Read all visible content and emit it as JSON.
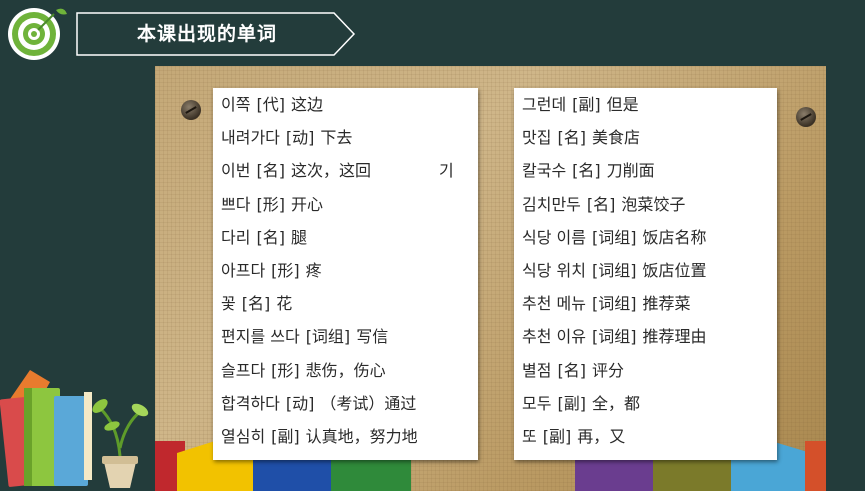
{
  "header": {
    "title": "本课出现的单词"
  },
  "colors": {
    "background": "#233c3b",
    "accent_green": "#6fb33a"
  },
  "icons": [
    "target-icon",
    "books-icon",
    "plant-icon"
  ],
  "vocab_left": [
    {
      "word": "이쪽",
      "pos": "[代]",
      "meaning": "这边"
    },
    {
      "word": "내려가다",
      "pos": "[动]",
      "meaning": "下去"
    },
    {
      "word": "이번",
      "pos": "[名]",
      "meaning": "这次，这回",
      "extra": "기"
    },
    {
      "word": "쁘다",
      "pos": "[形]",
      "meaning": "开心"
    },
    {
      "word": "다리",
      "pos": "[名]",
      "meaning": "腿"
    },
    {
      "word": "아프다",
      "pos": "[形]",
      "meaning": "疼"
    },
    {
      "word": "꽃",
      "pos": "[名]",
      "meaning": "花"
    },
    {
      "word": "편지를 쓰다",
      "pos": "[词组]",
      "meaning": "写信"
    },
    {
      "word": "슬프다",
      "pos": "[形]",
      "meaning": "悲伤，伤心"
    },
    {
      "word": "합격하다",
      "pos": "[动]",
      "meaning": "（考试）通过"
    },
    {
      "word": "열심히",
      "pos": "[副]",
      "meaning": "认真地，努力地"
    }
  ],
  "vocab_right": [
    {
      "word": "그런데",
      "pos": "[副]",
      "meaning": "但是"
    },
    {
      "word": "맛집",
      "pos": "[名]",
      "meaning": "美食店"
    },
    {
      "word": "칼국수",
      "pos": "[名]",
      "meaning": "刀削面"
    },
    {
      "word": "김치만두",
      "pos": "[名]",
      "meaning": "泡菜饺子"
    },
    {
      "word": "식당 이름",
      "pos": "[词组]",
      "meaning": "饭店名称"
    },
    {
      "word": "식당 위치",
      "pos": "[词组]",
      "meaning": "饭店位置"
    },
    {
      "word": "추천 메뉴",
      "pos": "[词组]",
      "meaning": "推荐菜"
    },
    {
      "word": "추천 이유",
      "pos": "[词组]",
      "meaning": "推荐理由"
    },
    {
      "word": "별점",
      "pos": "[名]",
      "meaning": "评分"
    },
    {
      "word": "모두",
      "pos": "[副]",
      "meaning": "全，都"
    },
    {
      "word": "또",
      "pos": "[副]",
      "meaning": "再，又"
    }
  ]
}
